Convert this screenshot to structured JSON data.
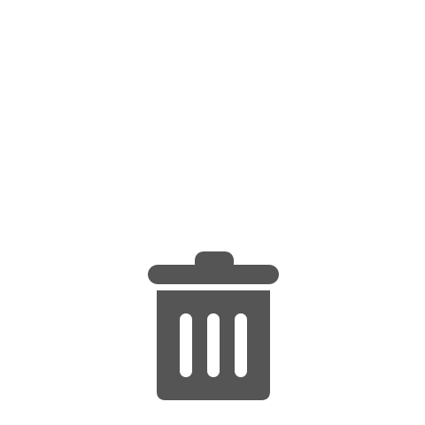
{
  "icon": {
    "name": "trash-icon",
    "color": "#555555",
    "slot_color": "#ffffff"
  }
}
